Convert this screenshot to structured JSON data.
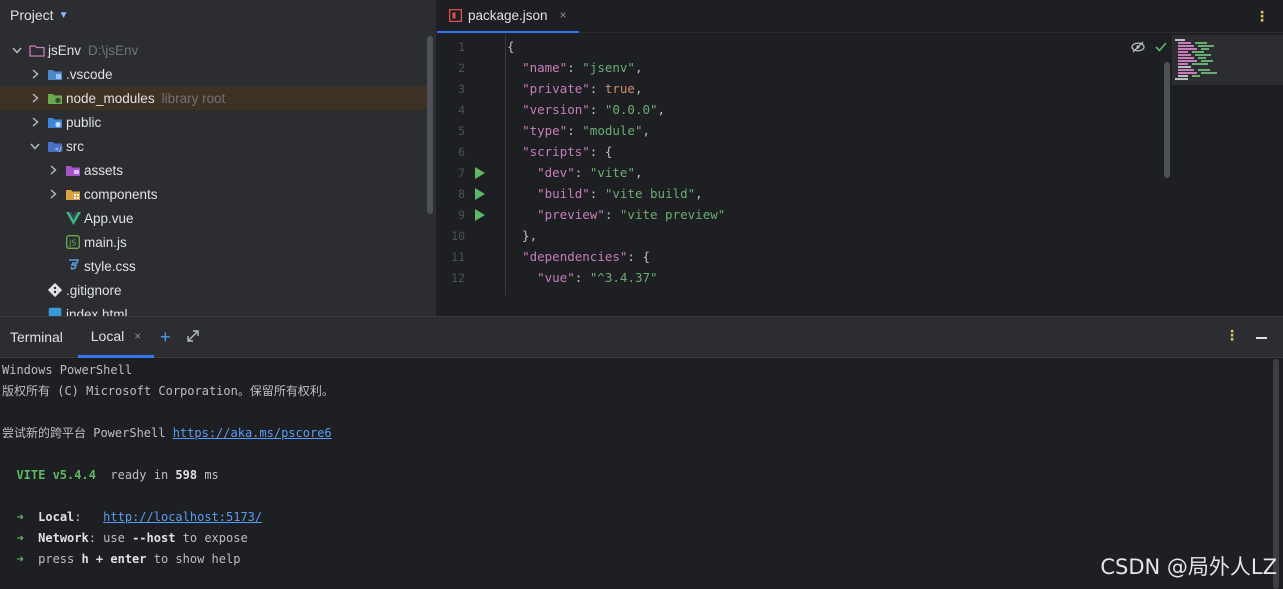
{
  "project": {
    "title": "Project",
    "tree": [
      {
        "label": "jsEnv",
        "hint": "D:\\jsEnv",
        "icon": "project-folder-icon",
        "arrow": "down",
        "indent": 0
      },
      {
        "label": ".vscode",
        "hint": "",
        "icon": "vscode-folder-icon",
        "arrow": "right",
        "indent": 1
      },
      {
        "label": "node_modules",
        "hint": "library root",
        "icon": "node-modules-folder-icon",
        "arrow": "right",
        "indent": 1,
        "selected": true
      },
      {
        "label": "public",
        "hint": "",
        "icon": "public-folder-icon",
        "arrow": "right",
        "indent": 1
      },
      {
        "label": "src",
        "hint": "",
        "icon": "src-folder-icon",
        "arrow": "down",
        "indent": 1
      },
      {
        "label": "assets",
        "hint": "",
        "icon": "assets-folder-icon",
        "arrow": "right",
        "indent": 2
      },
      {
        "label": "components",
        "hint": "",
        "icon": "components-folder-icon",
        "arrow": "right",
        "indent": 2
      },
      {
        "label": "App.vue",
        "hint": "",
        "icon": "vue-file-icon",
        "arrow": "",
        "indent": 2
      },
      {
        "label": "main.js",
        "hint": "",
        "icon": "js-file-icon",
        "arrow": "",
        "indent": 2
      },
      {
        "label": "style.css",
        "hint": "",
        "icon": "css-file-icon",
        "arrow": "",
        "indent": 2
      },
      {
        "label": ".gitignore",
        "hint": "",
        "icon": "git-file-icon",
        "arrow": "",
        "indent": 1
      },
      {
        "label": "index.html",
        "hint": "",
        "icon": "html-file-icon",
        "arrow": "",
        "indent": 1
      }
    ]
  },
  "editor": {
    "tab": {
      "label": "package.json",
      "close": "×"
    },
    "lines": [
      {
        "n": "1",
        "run": false,
        "tokens": [
          [
            "p",
            "{"
          ]
        ]
      },
      {
        "n": "2",
        "run": false,
        "tokens": [
          [
            "p",
            "  "
          ],
          [
            "k",
            "\"name\""
          ],
          [
            "p",
            ": "
          ],
          [
            "s",
            "\"jsenv\""
          ],
          [
            "p",
            ","
          ]
        ]
      },
      {
        "n": "3",
        "run": false,
        "tokens": [
          [
            "p",
            "  "
          ],
          [
            "k",
            "\"private\""
          ],
          [
            "p",
            ": "
          ],
          [
            "kw",
            "true"
          ],
          [
            "p",
            ","
          ]
        ]
      },
      {
        "n": "4",
        "run": false,
        "tokens": [
          [
            "p",
            "  "
          ],
          [
            "k",
            "\"version\""
          ],
          [
            "p",
            ": "
          ],
          [
            "s",
            "\"0.0.0\""
          ],
          [
            "p",
            ","
          ]
        ]
      },
      {
        "n": "5",
        "run": false,
        "tokens": [
          [
            "p",
            "  "
          ],
          [
            "k",
            "\"type\""
          ],
          [
            "p",
            ": "
          ],
          [
            "s",
            "\"module\""
          ],
          [
            "p",
            ","
          ]
        ]
      },
      {
        "n": "6",
        "run": false,
        "tokens": [
          [
            "p",
            "  "
          ],
          [
            "k",
            "\"scripts\""
          ],
          [
            "p",
            ": {"
          ]
        ]
      },
      {
        "n": "7",
        "run": true,
        "tokens": [
          [
            "p",
            "    "
          ],
          [
            "k",
            "\"dev\""
          ],
          [
            "p",
            ": "
          ],
          [
            "s",
            "\"vite\""
          ],
          [
            "p",
            ","
          ]
        ]
      },
      {
        "n": "8",
        "run": true,
        "tokens": [
          [
            "p",
            "    "
          ],
          [
            "k",
            "\"build\""
          ],
          [
            "p",
            ": "
          ],
          [
            "s",
            "\"vite build\""
          ],
          [
            "p",
            ","
          ]
        ]
      },
      {
        "n": "9",
        "run": true,
        "tokens": [
          [
            "p",
            "    "
          ],
          [
            "k",
            "\"preview\""
          ],
          [
            "p",
            ": "
          ],
          [
            "s",
            "\"vite preview\""
          ]
        ]
      },
      {
        "n": "10",
        "run": false,
        "tokens": [
          [
            "p",
            "  },"
          ]
        ]
      },
      {
        "n": "11",
        "run": false,
        "tokens": [
          [
            "p",
            "  "
          ],
          [
            "k",
            "\"dependencies\""
          ],
          [
            "p",
            ": {"
          ]
        ]
      },
      {
        "n": "12",
        "run": false,
        "tokens": [
          [
            "p",
            "    "
          ],
          [
            "k",
            "\"vue\""
          ],
          [
            "p",
            ": "
          ],
          [
            "s",
            "\"^3.4.37\""
          ]
        ]
      }
    ]
  },
  "terminal": {
    "title": "Terminal",
    "tab": {
      "label": "Local",
      "close": "×"
    },
    "add": "+",
    "lines": [
      [
        [
          "t",
          "Windows PowerShell"
        ]
      ],
      [
        [
          "t",
          "版权所有 (C) Microsoft Corporation。保留所有权利。"
        ]
      ],
      [
        [
          "t",
          ""
        ]
      ],
      [
        [
          "t",
          "尝试新的跨平台 PowerShell "
        ],
        [
          "link",
          "https://aka.ms/pscore6"
        ]
      ],
      [
        [
          "t",
          ""
        ]
      ],
      [
        [
          "t",
          "  "
        ],
        [
          "vite",
          "VITE v5.4.4"
        ],
        [
          "t",
          "  ready in "
        ],
        [
          "bold",
          "598"
        ],
        [
          "t",
          " ms"
        ]
      ],
      [
        [
          "t",
          ""
        ]
      ],
      [
        [
          "t",
          "  "
        ],
        [
          "arr",
          "➜"
        ],
        [
          "t",
          "  "
        ],
        [
          "bold",
          "Local"
        ],
        [
          "t",
          ":   "
        ],
        [
          "link",
          "http://localhost:5173/"
        ]
      ],
      [
        [
          "t",
          "  "
        ],
        [
          "arr",
          "➜"
        ],
        [
          "t",
          "  "
        ],
        [
          "bold",
          "Network"
        ],
        [
          "t",
          ": use "
        ],
        [
          "bold",
          "--host"
        ],
        [
          "t",
          " to expose"
        ]
      ],
      [
        [
          "t",
          "  "
        ],
        [
          "arr",
          "➜"
        ],
        [
          "t",
          "  press "
        ],
        [
          "bold",
          "h + enter"
        ],
        [
          "t",
          " to show help"
        ]
      ]
    ]
  },
  "watermark": "CSDN @局外人LZ"
}
